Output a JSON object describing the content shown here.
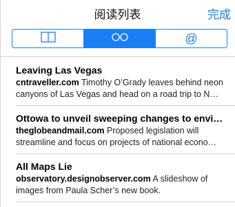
{
  "nav": {
    "title": "阅读列表",
    "done_label": "完成"
  },
  "segments": [
    {
      "icon": "book-icon",
      "selected": false
    },
    {
      "icon": "reading-glasses-icon",
      "selected": true
    },
    {
      "icon": "at-sign-icon",
      "glyph": "@",
      "selected": false
    }
  ],
  "items": [
    {
      "title": "Leaving Las Vegas",
      "source": "cntraveller.com",
      "description": "Timothy O’Grady leaves behind neon canyons of Las Vegas and head on a road trip to N…"
    },
    {
      "title": "Ottowa to unveil sweeping changes to envi…",
      "source": "theglobeandmail.com",
      "description": "Proposed legislation will streamline and focus on projects of national econo…"
    },
    {
      "title": "All Maps Lie",
      "source": "observatory.designobserver.com",
      "description": "A slideshow of images from Paula Scher’s new book."
    }
  ],
  "colors": {
    "accent": "#1a7ef5",
    "separator": "#d6d6d6"
  }
}
